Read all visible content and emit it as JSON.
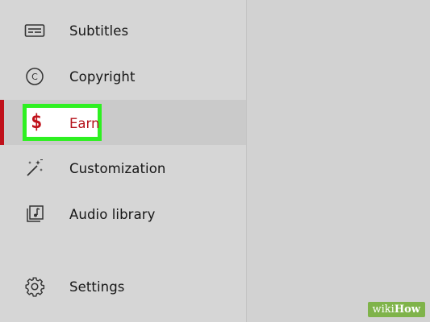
{
  "sidebar": {
    "items": [
      {
        "label": "Subtitles",
        "icon": "subtitles-icon"
      },
      {
        "label": "Copyright",
        "icon": "copyright-icon"
      },
      {
        "label": "Earn",
        "icon": "dollar-icon",
        "active": true
      },
      {
        "label": "Customization",
        "icon": "magic-wand-icon"
      },
      {
        "label": "Audio library",
        "icon": "audio-library-icon"
      },
      {
        "label": "Settings",
        "icon": "gear-icon"
      }
    ]
  },
  "highlight": {
    "symbol": "$",
    "label": "Earn"
  },
  "watermark": {
    "wiki": "wiki",
    "how": "How"
  },
  "colors": {
    "accent": "#c0101a",
    "highlight_border": "#2ef021",
    "sidebar_bg": "#d6d6d6"
  }
}
